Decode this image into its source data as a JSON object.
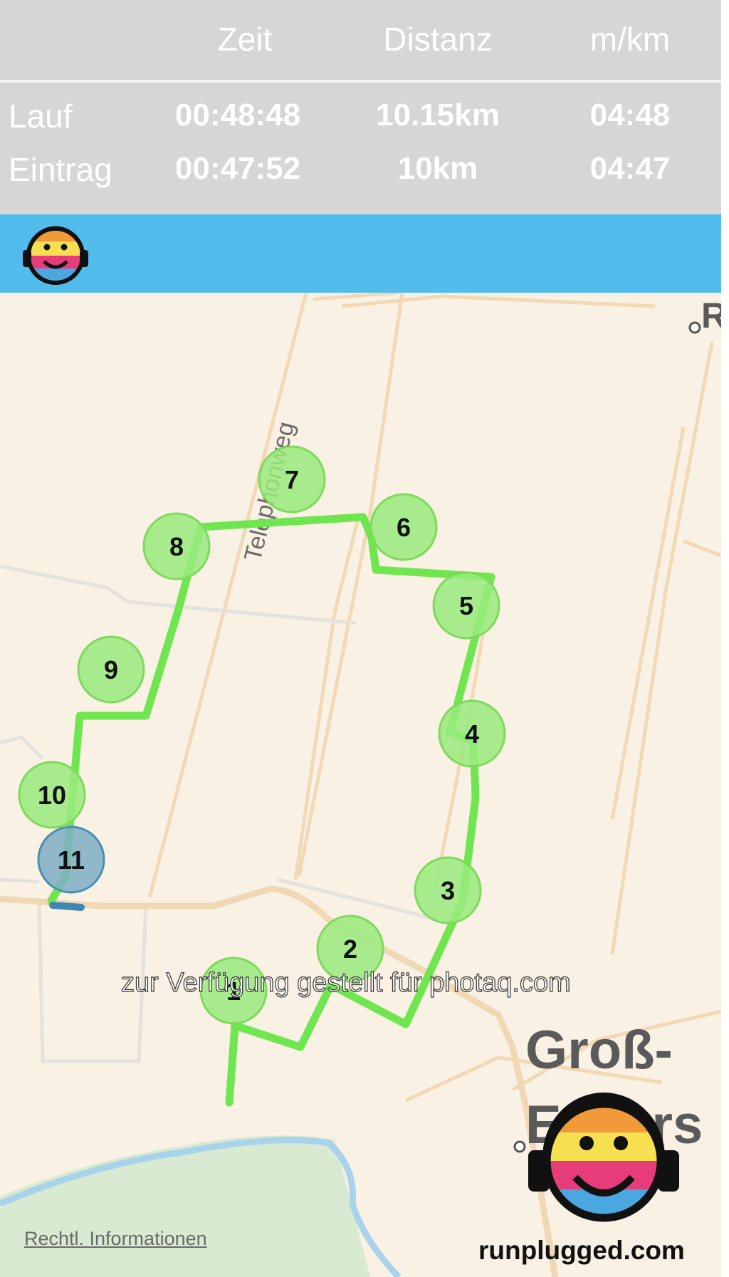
{
  "stats": {
    "headers": {
      "zeit": "Zeit",
      "distanz": "Distanz",
      "pace": "m/km"
    },
    "rows": [
      {
        "label": "Lauf",
        "zeit": "00:48:48",
        "distanz": "10.15km",
        "pace": "04:48"
      },
      {
        "label": "Eintrag",
        "zeit": "00:47:52",
        "distanz": "10km",
        "pace": "04:47"
      }
    ]
  },
  "map": {
    "street_labels": {
      "telephonweg": "Telephonweg"
    },
    "town_label": {
      "line1": "Groß-",
      "line2": "Enzers"
    },
    "corner_label": "R",
    "markers": [
      "1",
      "2",
      "3",
      "4",
      "5",
      "6",
      "7",
      "8",
      "9",
      "10",
      "11"
    ],
    "route_color": "#6fe64f",
    "marker_color": "#99ea7e",
    "last_marker_color": "#7eaec4"
  },
  "watermark": "zur Verfügung gestellt für photaq.com",
  "legal_link": "Rechtl. Informationen",
  "brand": "runplugged.com",
  "colors": {
    "header_bg": "#d6d6d6",
    "bar_blue": "#52bced",
    "map_bg": "#f8f1e4"
  }
}
